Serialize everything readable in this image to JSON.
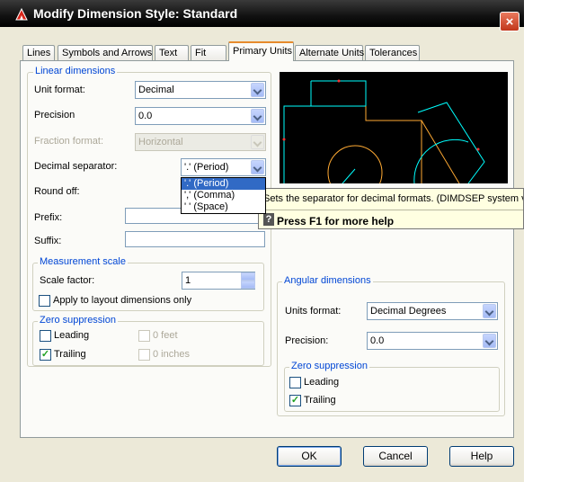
{
  "window": {
    "title": "Modify Dimension Style: Standard"
  },
  "tabs": [
    {
      "label": "Lines"
    },
    {
      "label": "Symbols and Arrows"
    },
    {
      "label": "Text"
    },
    {
      "label": "Fit"
    },
    {
      "label": "Primary Units"
    },
    {
      "label": "Alternate Units"
    },
    {
      "label": "Tolerances"
    }
  ],
  "linear": {
    "title": "Linear dimensions",
    "unit_format_label": "Unit format:",
    "unit_format_value": "Decimal",
    "precision_label": "Precision",
    "precision_value": "0.0",
    "fraction_label": "Fraction format:",
    "fraction_value": "Horizontal",
    "decimal_sep_label": "Decimal separator:",
    "decimal_sep_value": "'.' (Period)",
    "decimal_sep_options": [
      "'.' (Period)",
      "',' (Comma)",
      "' ' (Space)"
    ],
    "roundoff_label": "Round off:",
    "prefix_label": "Prefix:",
    "suffix_label": "Suffix:"
  },
  "measurement": {
    "title": "Measurement scale",
    "scale_label": "Scale factor:",
    "scale_value": "1",
    "layout_label": "Apply to layout dimensions only"
  },
  "zero_linear": {
    "title": "Zero suppression",
    "leading_label": "Leading",
    "trailing_label": "Trailing",
    "feet_label": "0 feet",
    "inches_label": "0 inches"
  },
  "angular": {
    "title": "Angular dimensions",
    "units_label": "Units format:",
    "units_value": "Decimal Degrees",
    "precision_label": "Precision:",
    "precision_value": "0.0"
  },
  "zero_angular": {
    "title": "Zero suppression",
    "leading_label": "Leading",
    "trailing_label": "Trailing"
  },
  "tooltip": {
    "description": "Sets the separator for decimal formats. (DIMDSEP system va",
    "help_icon": "?",
    "help": "Press F1 for more help"
  },
  "buttons": {
    "ok": "OK",
    "cancel": "Cancel",
    "help": "Help"
  },
  "icons": {
    "close": "×",
    "check": "✓"
  },
  "colors": {
    "preview_bg": "#000000",
    "cyan": "#00ffff",
    "orange": "#ffaa33",
    "group_label": "#0046d5",
    "active_tab": "#e68b2c"
  }
}
